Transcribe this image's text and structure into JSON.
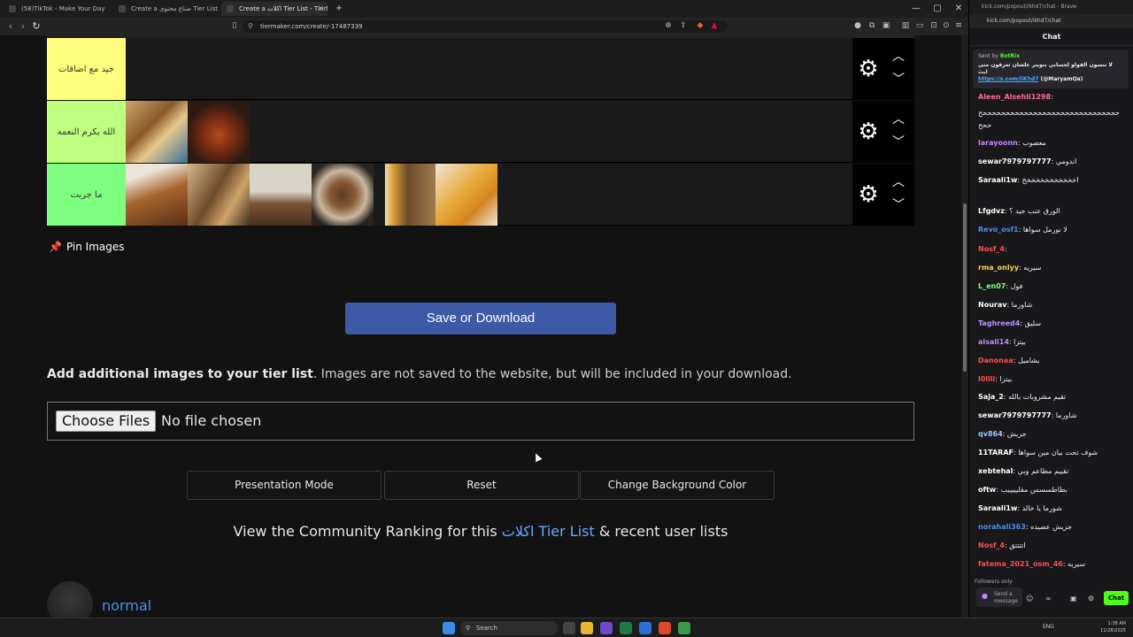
{
  "browser": {
    "tabs": [
      {
        "label": "(58)TikTok - Make Your Day"
      },
      {
        "label": "Create a صناع محتوى Tier List - TierMaker"
      },
      {
        "label": "Create a اكلات Tier List - TierMaker",
        "active": true
      }
    ],
    "url": "tiermaker.com/create/-17487339",
    "new_tab": "+",
    "window_controls": [
      "—",
      "▢",
      "✕"
    ]
  },
  "tiers": [
    {
      "label": "جيد مع اضافات",
      "color": "#ffff7f",
      "images": 0
    },
    {
      "label": "الله يكرم النعمه",
      "color": "#bfff7f",
      "images": 2
    },
    {
      "label": "ما جربت",
      "color": "#7fff7f",
      "images": 6
    }
  ],
  "pin_images": "Pin Images",
  "save_button": "Save or Download",
  "add_images": {
    "bold": "Add additional images to your tier list",
    "rest": ". Images are not saved to the website, but will be included in your download."
  },
  "file_input": {
    "button": "Choose Files",
    "status": "No file chosen"
  },
  "actions": {
    "presentation": "Presentation Mode",
    "reset": "Reset",
    "background": "Change Background Color"
  },
  "community": {
    "prefix": "View the Community Ranking for this ",
    "link": "اكلات Tier List",
    "suffix": " & recent user lists"
  },
  "profile": {
    "name": "normal"
  },
  "chat": {
    "window_title": "kick.com/popout/ikhd7/chat - Brave",
    "url": "kick.com/popout/ikhd7/chat",
    "header": "Chat",
    "pinned": {
      "sent_by": "Sent by",
      "bot": "BotRix",
      "text": "لا تنسون القولو لحسابي بتويتر علشان تعرفون متى ابث",
      "link": "https://x.com/iiKhd7",
      "handle": " (@MaryamQa)"
    },
    "messages": [
      {
        "user": "Aleen_Alsehli1298",
        "color": "#ff6b9a",
        "text": ""
      },
      {
        "user": "",
        "color": "#ffffff",
        "text": "ححححححححححححححححححححححححححححححح"
      },
      {
        "user": "",
        "color": "#ffffff",
        "text": "ححح"
      },
      {
        "user": "larayoonn",
        "color": "#c08aff",
        "text": "معصوب"
      },
      {
        "user": "sewar7979797777",
        "color": "#ffffff",
        "text": "اندومي"
      },
      {
        "user": "Saraali1w",
        "color": "#ffffff",
        "text": "اخخخخخخخخخخخخ"
      },
      {
        "user": "Lfgdvz",
        "color": "#ffffff",
        "text": "الورق عنب جيد ؟"
      },
      {
        "user": "Revo_osf1",
        "color": "#4f8ee8",
        "text": "لا نورمل سواها"
      },
      {
        "user": "Nosf_4",
        "color": "#ff4d4d",
        "text": ""
      },
      {
        "user": "rma_onlyy",
        "color": "#ffd24d",
        "text": "سيريه"
      },
      {
        "user": "L_en07",
        "color": "#7fff7f",
        "text": "فول"
      },
      {
        "user": "Nourav",
        "color": "#ffffff",
        "text": "شاورما"
      },
      {
        "user": "Taghreed4",
        "color": "#c08aff",
        "text": "سليق"
      },
      {
        "user": "aisali14",
        "color": "#c08aff",
        "text": "بيتزا"
      },
      {
        "user": "Danonaa",
        "color": "#ff4d4d",
        "text": "بشاميل"
      },
      {
        "user": "l0llli",
        "color": "#ff4d4d",
        "text": "بيتزا"
      },
      {
        "user": "Saja_2",
        "color": "#ffffff",
        "text": "تقيم مشروبات بالله"
      },
      {
        "user": "sewar7979797777",
        "color": "#ffffff",
        "text": "شاورما"
      },
      {
        "user": "qv864",
        "color": "#9ec5ff",
        "text": "جريش"
      },
      {
        "user": "11TARAF",
        "color": "#ffffff",
        "text": "شوف تحت بيان مين سواها"
      },
      {
        "user": "xebtehal",
        "color": "#ffffff",
        "text": "تقييم مطاعم وبي"
      },
      {
        "user": "oftw",
        "color": "#ffffff",
        "text": "بطاطسسس مقليييييب"
      },
      {
        "user": "Saraali1w",
        "color": "#ffffff",
        "text": "شورما يا خالد"
      },
      {
        "user": "norahali363",
        "color": "#4f8ee8",
        "text": "جريش عصيده"
      },
      {
        "user": "Nosf_4",
        "color": "#ff4d4d",
        "text": "اتتتتق"
      },
      {
        "user": "fatema_2021_osm_46",
        "color": "#ff4d4d",
        "text": "سيريه"
      }
    ],
    "followers_only": "Followers only",
    "input_placeholder": "Send a message",
    "send_label": "Chat"
  },
  "taskbar": {
    "search": "Search",
    "lang": "ENG",
    "time": "1:38 AM",
    "date": "11/28/2025"
  },
  "colors": {
    "save_button": "#3d5aa6",
    "link": "#6aa8ff",
    "kick_green": "#53fc18"
  }
}
